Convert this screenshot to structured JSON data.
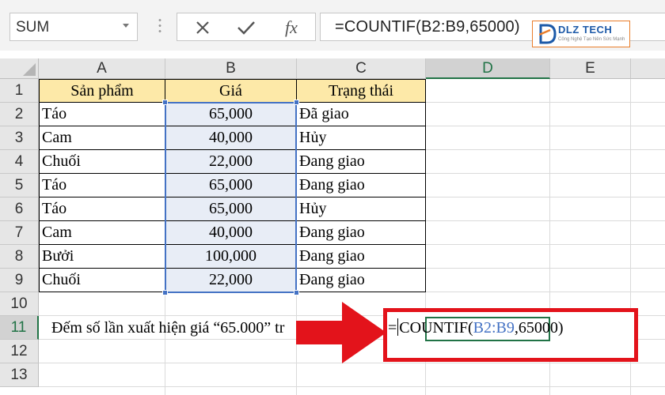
{
  "formula_bar": {
    "name_box": "SUM",
    "cancel_icon": "x-icon",
    "enter_icon": "check-icon",
    "fx_label": "fx",
    "formula": "=COUNTIF(B2:B9,65000)"
  },
  "logo": {
    "main": "DLZ TECH",
    "sub": "Công Nghệ Tạo Nên Sức Mạnh"
  },
  "columns": [
    "A",
    "B",
    "C",
    "D",
    "E"
  ],
  "active_column": "D",
  "rows": [
    "1",
    "2",
    "3",
    "4",
    "5",
    "6",
    "7",
    "8",
    "9",
    "10",
    "11",
    "12",
    "13"
  ],
  "active_row": "11",
  "table": {
    "headers": [
      "Sản phẩm",
      "Giá",
      "Trạng thái"
    ],
    "rows": [
      [
        "Táo",
        "65,000",
        "Đã giao"
      ],
      [
        "Cam",
        "40,000",
        "Hủy"
      ],
      [
        "Chuối",
        "22,000",
        "Đang giao"
      ],
      [
        "Táo",
        "65,000",
        "Đang giao"
      ],
      [
        "Táo",
        "65,000",
        "Hủy"
      ],
      [
        "Cam",
        "40,000",
        "Đang giao"
      ],
      [
        "Bưởi",
        "100,000",
        "Đang giao"
      ],
      [
        "Chuối",
        "22,000",
        "Đang giao"
      ]
    ]
  },
  "row11": {
    "label_text": "Đếm số lần xuất hiện giá “65.000” tr",
    "edit_prefix": "=",
    "edit_fn": "COUNTIF(",
    "edit_ref": "B2:B9",
    "edit_suffix": ",65000)"
  },
  "colors": {
    "header_fill": "#fde9a8",
    "range_fill": "#e8edf6",
    "range_border": "#4472c4",
    "annotation_red": "#e3131b",
    "active_green": "#217346"
  }
}
